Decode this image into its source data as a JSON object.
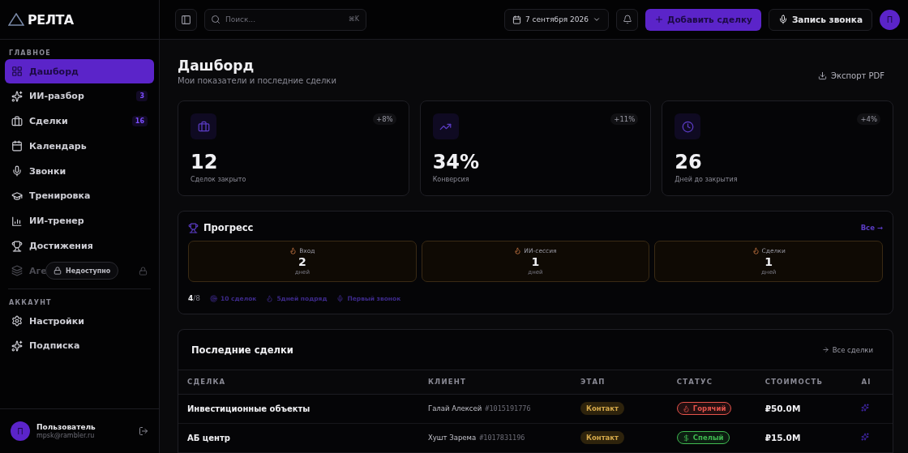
{
  "logo": {
    "text": "РЕЛТА"
  },
  "header": {
    "search": {
      "placeholder": "Поиск...",
      "shortcut": "⌘K"
    },
    "date": "7 сентября 2026",
    "add_button": "Добавить сделку",
    "record_button": "Запись звонка",
    "avatar": "П"
  },
  "sidebar": {
    "sections": [
      {
        "title": "ГЛАВНОЕ",
        "items": [
          {
            "label": "Дашборд",
            "selected": true,
            "disabled": false
          },
          {
            "label": "ИИ-разбор",
            "badge": "3",
            "selected": false,
            "disabled": false
          },
          {
            "label": "Сделки",
            "badge": "16",
            "selected": false,
            "disabled": false
          },
          {
            "label": "Календарь",
            "selected": false,
            "disabled": false
          },
          {
            "label": "Звонки",
            "selected": false,
            "disabled": false
          },
          {
            "label": "Тренировка",
            "selected": false,
            "disabled": false
          },
          {
            "label": "ИИ-тренер",
            "selected": false,
            "disabled": false
          },
          {
            "label": "Достижения",
            "selected": false,
            "disabled": false
          },
          {
            "label": "Аге",
            "tooltip": "Недоступно",
            "selected": false,
            "disabled": true
          }
        ]
      },
      {
        "title": "АККАУНТ",
        "items": [
          {
            "label": "Настройки",
            "selected": false,
            "disabled": false
          },
          {
            "label": "Подписка",
            "selected": false,
            "disabled": false
          }
        ]
      }
    ],
    "user": {
      "avatar": "П",
      "name": "Пользователь",
      "email": "mpsk@rambler.ru"
    }
  },
  "page": {
    "title": "Дашборд",
    "subtitle": "Мои показатели и последние сделки",
    "export_button": "Экспорт PDF"
  },
  "stats": [
    {
      "value": "12",
      "label": "Сделок закрыто",
      "change": "+8%"
    },
    {
      "value": "34%",
      "label": "Конверсия",
      "change": "+11%"
    },
    {
      "value": "26",
      "label": "Дней до закрытия",
      "change": "+4%"
    }
  ],
  "progress": {
    "title": "Прогресс",
    "all_link": "Все →",
    "streaks": [
      {
        "label": "Вход",
        "value": "2",
        "unit": "дней"
      },
      {
        "label": "ИИ-сессия",
        "value": "1",
        "unit": "дней"
      },
      {
        "label": "Сделки",
        "value": "1",
        "unit": "дней"
      }
    ],
    "count": "**4**/8",
    "achievements": [
      "10 сделок",
      "5дней подряд",
      "Первый звонок"
    ]
  },
  "deals": {
    "title": "Последние сделки",
    "all_link": "Все сделки",
    "columns": [
      "СДЕЛКА",
      "КЛИЕНТ",
      "ЭТАП",
      "СТАТУС",
      "СТОИМОСТЬ",
      "AI"
    ],
    "rows": [
      {
        "deal": "Инвестиционные объекты",
        "client": "Галай Алексей",
        "client_id": "#1015191776",
        "stage": "Контакт",
        "status": {
          "kind": "hot",
          "label": "Горячий",
          "color": "#e5534b"
        },
        "price": "₽50.0M"
      },
      {
        "deal": "АБ центр",
        "client": "Хушт Зарема",
        "client_id": "#1017831196",
        "stage": "Контакт",
        "status": {
          "kind": "ripe",
          "label": "Спелый",
          "color": "#3fb950"
        },
        "price": "₽15.0M"
      }
    ]
  }
}
